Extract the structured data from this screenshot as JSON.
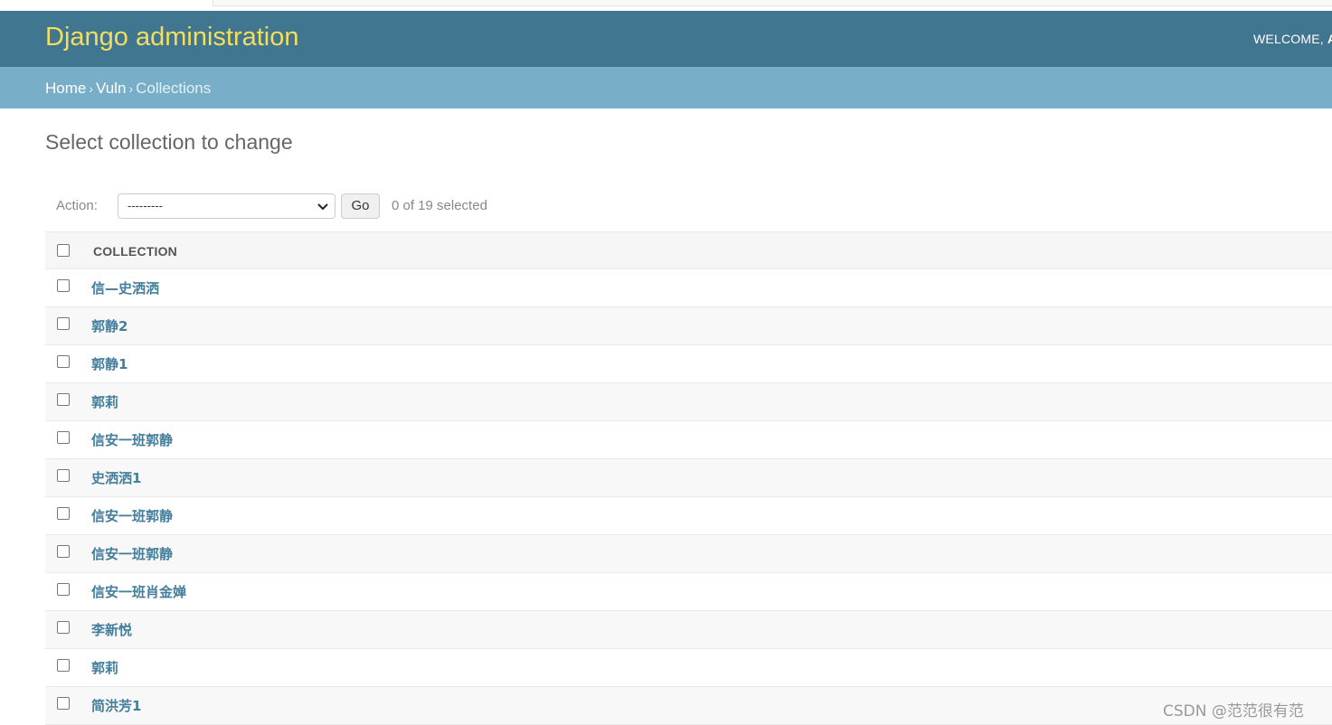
{
  "header": {
    "site_name": "Django administration",
    "user_tools": "WELCOME,",
    "user_name": "A"
  },
  "breadcrumbs": {
    "home": "Home",
    "app": "Vuln",
    "current": "Collections",
    "separator": "›"
  },
  "page": {
    "title": "Select collection to change"
  },
  "actions": {
    "label": "Action:",
    "selected_value": "---------",
    "go_label": "Go",
    "counter": "0 of 19 selected"
  },
  "table": {
    "column": "COLLECTION",
    "rows": [
      "信—史洒洒",
      "郭静2",
      "郭静1",
      "郭莉",
      "信安一班郭静",
      "史洒洒1",
      "信安一班郭静",
      "信安一班郭静",
      "信安一班肖金婵",
      "李新悦",
      "郭莉",
      "简洪芳1"
    ]
  },
  "watermark": "CSDN @范范很有范",
  "colors": {
    "header_bg": "#417690",
    "site_name": "#f5dd5d",
    "breadcrumb_bg": "#79aec8",
    "link": "#447e9b"
  }
}
